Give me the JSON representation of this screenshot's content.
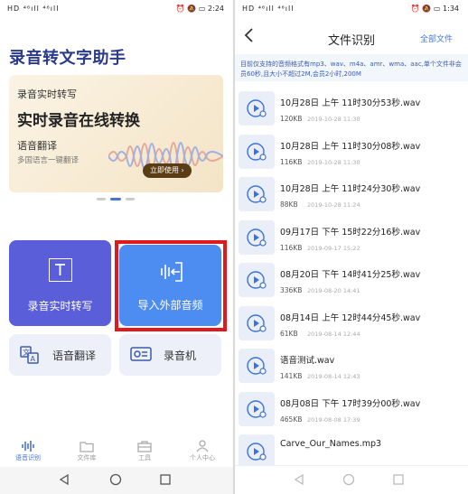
{
  "left": {
    "status": {
      "signal": "HD ⁴⁶ıll ⁴⁶ıll",
      "right_icons": "⏰ 🔕 ▭",
      "time": "2:24"
    },
    "app_title": "录音转文字助手",
    "banner": {
      "line1": "录音实时转写",
      "headline": "实时录音在线转换",
      "line3": "语音翻译",
      "line4": "多国语言一键翻译",
      "button": "立即使用 ›"
    },
    "tiles": {
      "realtime": "录音实时转写",
      "import": "导入外部音频",
      "translate": "语音翻译",
      "recorder": "录音机"
    },
    "tabs": [
      {
        "label": "语音识别",
        "icon": "voice-wave-icon",
        "active": true
      },
      {
        "label": "文件库",
        "icon": "folder-icon",
        "active": false
      },
      {
        "label": "工具",
        "icon": "toolbox-icon",
        "active": false
      },
      {
        "label": "个人中心",
        "icon": "person-icon",
        "active": false
      }
    ],
    "colors": {
      "brand": "#2a3a8c",
      "tile_realtime": "#5a5ed9",
      "tile_import": "#4d8df2",
      "highlight": "#e0191f"
    }
  },
  "right": {
    "status": {
      "signal": "HD ⁴⁶ıll ⁴⁶ıll",
      "right_icons": "⏰ 🔕 ▭",
      "time": "1:34"
    },
    "title": "文件识别",
    "all_files": "全部文件",
    "notice": "目前仅支持的音频格式有mp3、wav、m4a、amr、wma、aac,单个文件非会员60秒,且大小不超过2M,会员2小时,200M",
    "files": [
      {
        "name": "10月28日 上午 11时30分53秒.wav",
        "size": "120KB",
        "date": "2019-10-28 11:30"
      },
      {
        "name": "10月28日 上午 11时30分08秒.wav",
        "size": "116KB",
        "date": "2019-10-28 11:30"
      },
      {
        "name": "10月28日 上午 11时24分30秒.wav",
        "size": "88KB",
        "date": "2019-10-28 11:24"
      },
      {
        "name": "09月17日 下午 15时22分16秒.wav",
        "size": "116KB",
        "date": "2019-09-17 15:22"
      },
      {
        "name": "08月20日 下午 14时41分25秒.wav",
        "size": "336KB",
        "date": "2019-08-20 14:41"
      },
      {
        "name": "08月14日 上午 12时44分45秒.wav",
        "size": "61KB",
        "date": "2019-08-14 12:44"
      },
      {
        "name": "语音测试.wav",
        "size": "141KB",
        "date": "2019-08-14 12:43"
      },
      {
        "name": "08月08日 下午 17时39分00秒.wav",
        "size": "465KB",
        "date": "2019-08-08 17:39"
      },
      {
        "name": "Carve_Our_Names.mp3",
        "size": "",
        "date": ""
      }
    ]
  }
}
